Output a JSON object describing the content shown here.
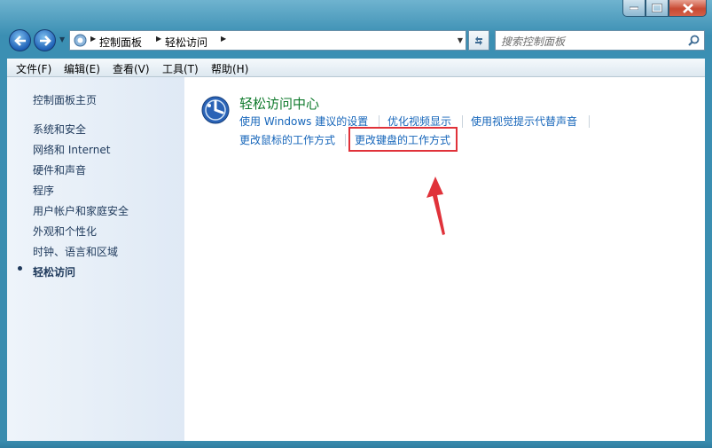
{
  "nav": {
    "breadcrumb": [
      "控制面板",
      "轻松访问"
    ]
  },
  "search": {
    "placeholder": "搜索控制面板"
  },
  "menubar": {
    "items": [
      "文件(F)",
      "编辑(E)",
      "查看(V)",
      "工具(T)",
      "帮助(H)"
    ]
  },
  "sidebar": {
    "home": "控制面板主页",
    "items": [
      "系统和安全",
      "网络和 Internet",
      "硬件和声音",
      "程序",
      "用户帐户和家庭安全",
      "外观和个性化",
      "时钟、语言和区域",
      "轻松访问"
    ],
    "current_index": 7
  },
  "main": {
    "title": "轻松访问中心",
    "links": [
      "使用 Windows 建议的设置",
      "优化视频显示",
      "使用视觉提示代替声音",
      "更改鼠标的工作方式",
      "更改键盘的工作方式"
    ],
    "highlighted_link_index": 4
  },
  "colors": {
    "link": "#1565ba",
    "heading": "#0f7a2c",
    "annotation": "#e0323a"
  }
}
